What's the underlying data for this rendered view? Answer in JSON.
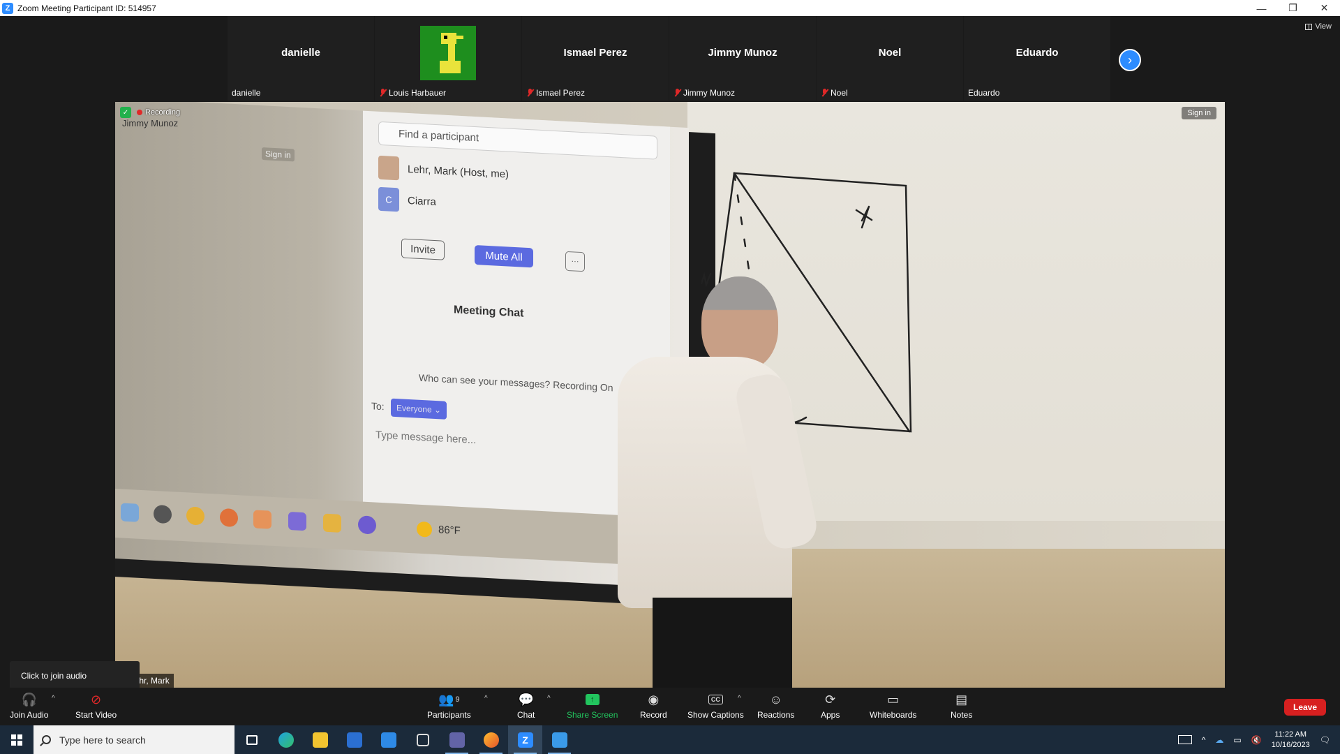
{
  "window": {
    "title": "Zoom Meeting Participant ID: 514957",
    "app_icon": "Z",
    "minimize": "—",
    "restore": "❐",
    "close": "✕"
  },
  "gallery": {
    "view_label": "View",
    "tiles": [
      {
        "big": "danielle",
        "small": "danielle",
        "muted": false
      },
      {
        "big": "",
        "small": "Louis Harbauer",
        "muted": true,
        "avatar": true
      },
      {
        "big": "Ismael Perez",
        "small": "Ismael Perez",
        "muted": true
      },
      {
        "big": "Jimmy Munoz",
        "small": "Jimmy Munoz",
        "muted": true
      },
      {
        "big": "Noel",
        "small": "Noel",
        "muted": true
      },
      {
        "big": "Eduardo",
        "small": "Eduardo",
        "muted": false
      }
    ],
    "next_icon": "›"
  },
  "video": {
    "recording_label": "Recording",
    "projected_name": "Jimmy Munoz",
    "projected_sign_in": "Sign in",
    "sign_in": "Sign in",
    "speaker_name": "Lehr, Mark",
    "projected_panel": {
      "search_placeholder": "Find a participant",
      "rows": [
        {
          "name": "Lehr, Mark (Host, me)"
        },
        {
          "initial": "C",
          "name": "Ciarra"
        }
      ],
      "invite": "Invite",
      "mute_all": "Mute All",
      "more": "···",
      "chat_title": "Meeting Chat",
      "who_can_see": "Who can see your messages? Recording On",
      "to_label": "To:",
      "everyone": "Everyone ⌄",
      "type_message": "Type message here...",
      "temperature": "86°F"
    }
  },
  "tooltip": {
    "text": "Click to join audio"
  },
  "toolbar": {
    "join_audio": "Join Audio",
    "start_video": "Start Video",
    "participants": "Participants",
    "participants_count": "9",
    "chat": "Chat",
    "share_screen": "Share Screen",
    "record": "Record",
    "show_captions": "Show Captions",
    "captions_icon": "CC",
    "reactions": "Reactions",
    "apps": "Apps",
    "whiteboards": "Whiteboards",
    "notes": "Notes",
    "leave": "Leave",
    "caret": "^"
  },
  "taskbar": {
    "search_placeholder": "Type here to search",
    "time": "11:22 AM",
    "date": "10/16/2023",
    "apps": [
      "task-view",
      "edge",
      "file-explorer",
      "store",
      "mail",
      "unity",
      "teams",
      "firefox",
      "zoom",
      "photos"
    ]
  },
  "colors": {
    "zoom_blue": "#2d8cff",
    "leave_red": "#d72020",
    "share_green": "#22c55e",
    "mute_red": "#e02828"
  }
}
